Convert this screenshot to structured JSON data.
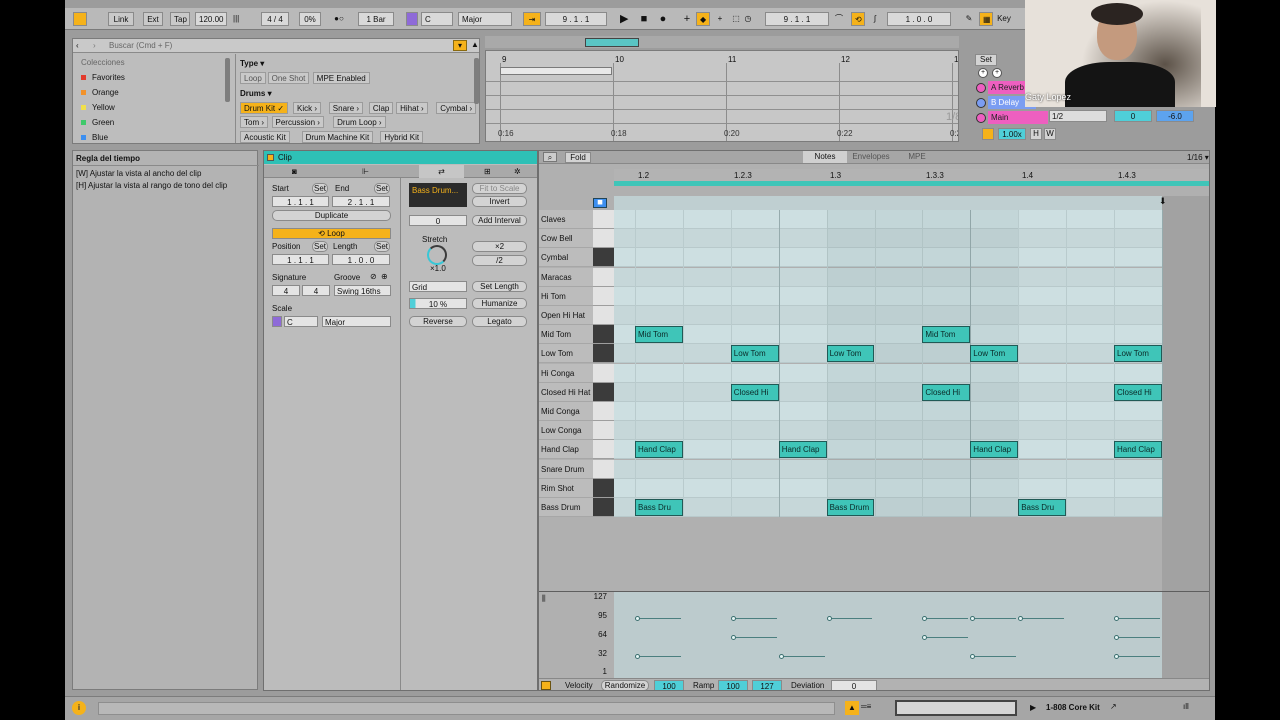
{
  "toolbar": {
    "link": "Link",
    "ext": "Ext",
    "tap": "Tap",
    "tempo": "120.00",
    "signature": "4 / 4",
    "groove_pct": "0%",
    "quant": "1 Bar",
    "key": "C",
    "scale": "Major",
    "position": "9 . 1 . 1",
    "loop_start": "9 . 1 . 1",
    "loop_length": "1 . 0 . 0",
    "key_map": "Key"
  },
  "browser": {
    "search_placeholder": "Buscar (Cmd + F)",
    "collections_title": "Colecciones",
    "collections": [
      {
        "label": "Favorites",
        "color": "#e23a2c"
      },
      {
        "label": "Orange",
        "color": "#f2922a"
      },
      {
        "label": "Yellow",
        "color": "#f1e04a"
      },
      {
        "label": "Green",
        "color": "#3fc96a"
      },
      {
        "label": "Blue",
        "color": "#3d8ff0"
      }
    ],
    "type_title": "Type ▾",
    "type_filters": [
      "Loop",
      "One Shot",
      "MPE Enabled"
    ],
    "drums_title": "Drums ▾",
    "drums_row1": [
      "Drum Kit ✓",
      "Kick ›",
      "Snare ›",
      "Clap",
      "Hihat ›",
      "Cymbal ›"
    ],
    "drums_row2": [
      "Tom ›",
      "Percussion ›",
      "Drum Loop ›"
    ],
    "drums_row3": [
      "Acoustic Kit",
      "Drum Machine Kit",
      "Hybrid Kit"
    ]
  },
  "arrangement": {
    "bars": [
      "9",
      "10",
      "11",
      "12",
      "13"
    ],
    "times": [
      "0:16",
      "0:18",
      "0:20",
      "0:22",
      "0:24"
    ],
    "set_label": "Set",
    "fraction": "1/8"
  },
  "mixer": {
    "tracks": [
      {
        "name": "A Reverb",
        "color": "#ee5fc0"
      },
      {
        "name": "B Delay",
        "color": "#7b9df2"
      },
      {
        "name": "Main",
        "color": "#ee5fc0"
      }
    ],
    "main_fraction": "1/2",
    "main_value": "0",
    "main_volume": "-6.0",
    "zoom": "1.00x",
    "h_label": "H",
    "w_label": "W"
  },
  "webcam": {
    "name": "Gaty Lopez"
  },
  "info": {
    "title": "Regla del tiempo",
    "line1": "[W] Ajustar la vista al ancho del clip",
    "line2": "[H] Ajustar la vista al rango de tono del clip"
  },
  "clip": {
    "title": "Clip",
    "start_label": "Start",
    "end_label": "End",
    "set": "Set",
    "start": "1 .   1 .   1",
    "end": "2 .   1 .   1",
    "duplicate": "Duplicate",
    "loop": "Loop",
    "position_label": "Position",
    "length_label": "Length",
    "position": "1 .   1 .   1",
    "length": "1 .   0 .   0",
    "signature_label": "Signature",
    "groove_label": "Groove",
    "sig_num": "4",
    "sig_den": "4",
    "groove": "Swing 16ths",
    "scale_label": "Scale",
    "scale_key": "C",
    "scale_mode": "Major",
    "sample_name": "Bass Drum...",
    "fit_to_scale": "Fit to Scale",
    "invert": "Invert",
    "interval_value": "0",
    "add_interval": "Add Interval",
    "stretch_label": "Stretch",
    "stretch_value": "×1.0",
    "x2": "×2",
    "div2": "/2",
    "grid": "Grid",
    "set_length": "Set Length",
    "humanize_pct": "10 %",
    "humanize": "Humanize",
    "reverse": "Reverse",
    "legato": "Legato"
  },
  "editor": {
    "fold": "Fold",
    "tabs": [
      "Notes",
      "Envelopes",
      "MPE"
    ],
    "grid": "1/16 ▾",
    "ruler": [
      "1.2",
      "1.2.3",
      "1.3",
      "1.3.3",
      "1.4",
      "1.4.3"
    ],
    "rows": [
      "Claves",
      "Cow Bell",
      "Cymbal",
      "Maracas",
      "Hi Tom",
      "Open Hi Hat",
      "Mid Tom",
      "Low Tom",
      "Hi Conga",
      "Closed Hi Hat",
      "Mid Conga",
      "Low Conga",
      "Hand Clap",
      "Snare Drum",
      "Rim Shot",
      "Bass Drum"
    ],
    "notes": [
      {
        "row": 6,
        "start": 1,
        "len": 1,
        "label": "Mid Tom"
      },
      {
        "row": 6,
        "start": 7,
        "len": 1,
        "label": "Mid Tom"
      },
      {
        "row": 7,
        "start": 3,
        "len": 1,
        "label": "Low Tom"
      },
      {
        "row": 7,
        "start": 5,
        "len": 1,
        "label": "Low Tom"
      },
      {
        "row": 7,
        "start": 8,
        "len": 1,
        "label": "Low Tom"
      },
      {
        "row": 7,
        "start": 11,
        "len": 1,
        "label": "Low Tom"
      },
      {
        "row": 9,
        "start": 3,
        "len": 1,
        "label": "Closed Hi"
      },
      {
        "row": 9,
        "start": 7,
        "len": 1,
        "label": "Closed Hi"
      },
      {
        "row": 9,
        "start": 11,
        "len": 1,
        "label": "Closed Hi"
      },
      {
        "row": 12,
        "start": 1,
        "len": 1,
        "label": "Hand Clap"
      },
      {
        "row": 12,
        "start": 4,
        "len": 1,
        "label": "Hand Clap"
      },
      {
        "row": 12,
        "start": 8,
        "len": 1,
        "label": "Hand Clap"
      },
      {
        "row": 12,
        "start": 11,
        "len": 1,
        "label": "Hand Clap"
      },
      {
        "row": 15,
        "start": 1,
        "len": 1,
        "label": "Bass Dru"
      },
      {
        "row": 15,
        "start": 5,
        "len": 1,
        "label": "Bass Drum"
      },
      {
        "row": 15,
        "start": 9,
        "len": 1,
        "label": "Bass Dru"
      }
    ],
    "velocity_ticks": [
      "127",
      "95",
      "64",
      "32",
      "1"
    ],
    "velocities": [
      {
        "step": 1,
        "v": 95
      },
      {
        "step": 3,
        "v": 95
      },
      {
        "step": 5,
        "v": 95
      },
      {
        "step": 7,
        "v": 95
      },
      {
        "step": 8,
        "v": 95
      },
      {
        "step": 9,
        "v": 95
      },
      {
        "step": 11,
        "v": 95
      },
      {
        "step": 3,
        "v": 64
      },
      {
        "step": 7,
        "v": 64
      },
      {
        "step": 11,
        "v": 64
      },
      {
        "step": 1,
        "v": 32
      },
      {
        "step": 4,
        "v": 32
      },
      {
        "step": 8,
        "v": 32
      },
      {
        "step": 11,
        "v": 32
      }
    ],
    "footer": {
      "velocity_label": "Velocity",
      "randomize": "Randomize",
      "velocity_value": "100",
      "ramp_label": "Ramp",
      "ramp_a": "100",
      "ramp_b": "127",
      "deviation_label": "Deviation",
      "deviation_value": "0"
    }
  },
  "status": {
    "track_name": "1-808 Core Kit"
  }
}
